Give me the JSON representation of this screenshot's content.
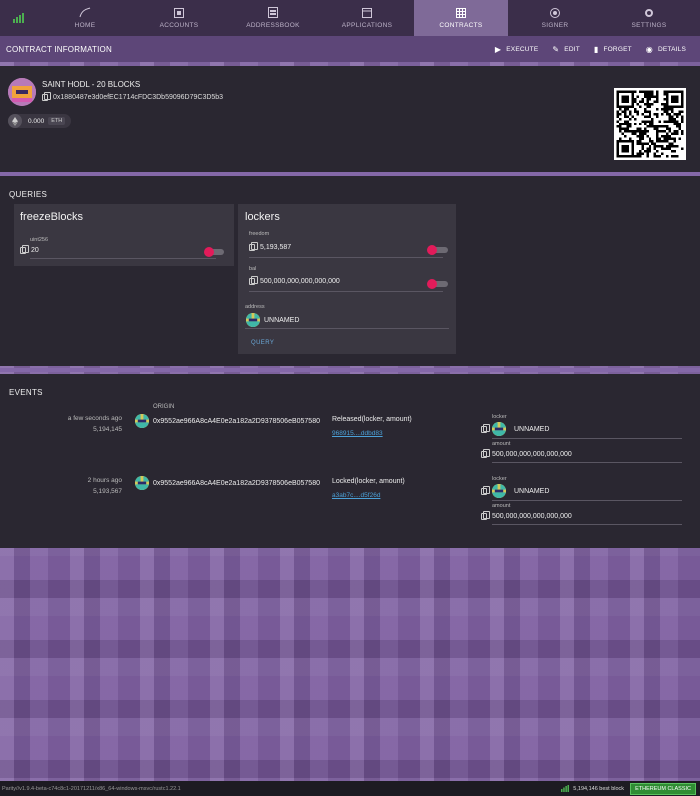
{
  "nav": {
    "tabs": [
      {
        "label": "HOME",
        "icon": "home-icon"
      },
      {
        "label": "ACCOUNTS",
        "icon": "accounts-icon"
      },
      {
        "label": "ADDRESSBOOK",
        "icon": "addressbook-icon"
      },
      {
        "label": "APPLICATIONS",
        "icon": "applications-icon"
      },
      {
        "label": "CONTRACTS",
        "icon": "contracts-icon",
        "active": true
      },
      {
        "label": "SIGNER",
        "icon": "signer-icon"
      },
      {
        "label": "SETTINGS",
        "icon": "gear-icon"
      }
    ]
  },
  "contract_bar": {
    "title": "CONTRACT INFORMATION",
    "actions": {
      "execute": "EXECUTE",
      "edit": "EDIT",
      "forget": "FORGET",
      "details": "DETAILS"
    }
  },
  "contract": {
    "name": "SAINT HODL - 20 BLOCKS",
    "address": "0x1880487e3d0efEC1714cFDC3Db59096D79C3D5b3",
    "balance": "0.000",
    "balance_unit": "ETH"
  },
  "queries": {
    "title": "QUERIES",
    "freeze": {
      "title": "freezeBlocks",
      "param_label": "uint256",
      "value": "20"
    },
    "lockers": {
      "title": "lockers",
      "freedom_label": "freedom",
      "freedom_value": "5,193,587",
      "bal_label": "bal",
      "bal_value": "500,000,000,000,000,000",
      "address_label": "address",
      "address_value": "UNNAMED",
      "query_label": "QUERY"
    }
  },
  "events": {
    "title": "EVENTS",
    "origin_label": "ORIGIN",
    "items": [
      {
        "time": "a few seconds ago",
        "block": "5,194,145",
        "origin": "0x9552ae966A8cA4E0e2a182a2D9378506eB057580",
        "name": "Released(locker, amount)",
        "tx": "968915....ddbd83",
        "locker_label": "locker",
        "locker_value": "UNNAMED",
        "amount_label": "amount",
        "amount_value": "500,000,000,000,000,000"
      },
      {
        "time": "2 hours ago",
        "block": "5,193,567",
        "origin": "0x9552ae966A8cA4E0e2a182a2D9378506eB057580",
        "name": "Locked(locker, amount)",
        "tx": "a3ab7c....d5f26d",
        "locker_label": "locker",
        "locker_value": "UNNAMED",
        "amount_label": "amount",
        "amount_value": "500,000,000,000,000,000"
      }
    ]
  },
  "status": {
    "version": "Parity//v1.9.4-beta-c74c8c1-20171211/x86_64-windows-msvc/rustc1.22.1",
    "best_block": "5,194,146 best block",
    "chain": "ETHEREUM CLASSIC"
  },
  "colors": {
    "accent": "#7f6a98",
    "toggle_on": "#e21b5a",
    "link": "#4ba1d8",
    "chain_badge": "#2f8d33"
  }
}
